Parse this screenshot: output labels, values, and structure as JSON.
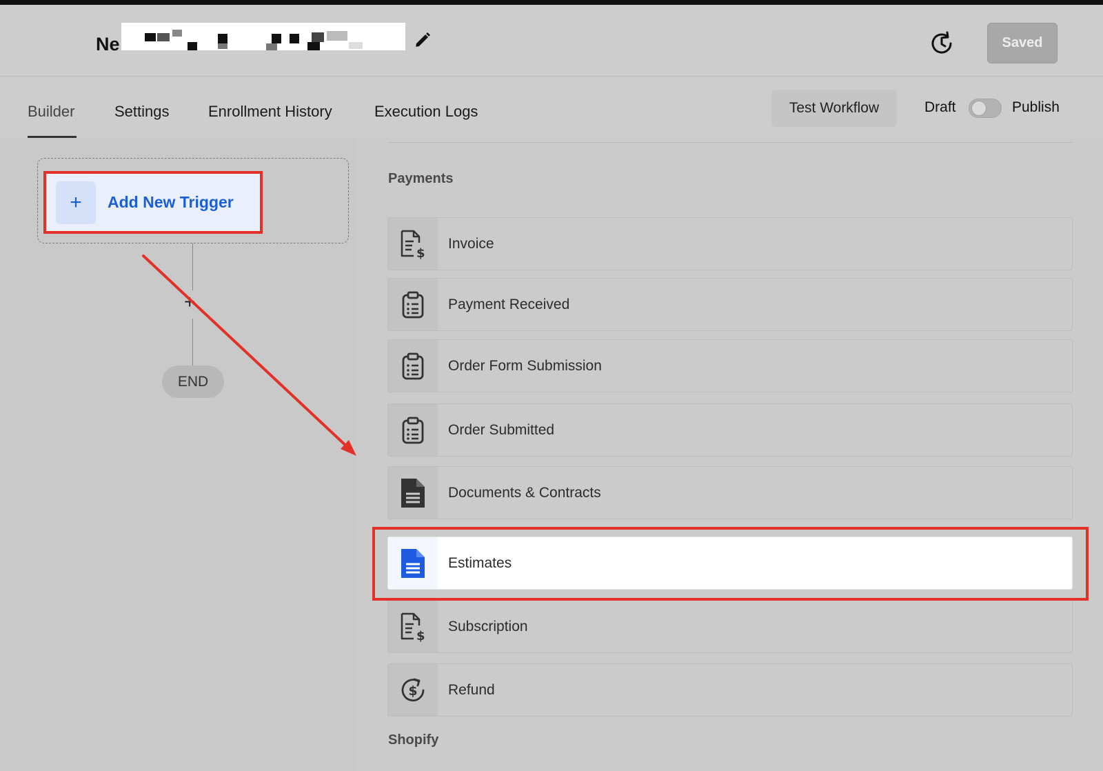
{
  "header": {
    "workflow_title": "Ne",
    "saved_label": "Saved"
  },
  "tabs": [
    {
      "label": "Builder"
    },
    {
      "label": "Settings"
    },
    {
      "label": "Enrollment History"
    },
    {
      "label": "Execution Logs"
    }
  ],
  "actions": {
    "test_label": "Test Workflow",
    "draft_label": "Draft",
    "publish_label": "Publish",
    "publish_enabled": false
  },
  "canvas": {
    "trigger_label": "Add New Trigger",
    "end_label": "END"
  },
  "panel": {
    "sections": [
      {
        "title": "Payments",
        "items": [
          {
            "label": "Invoice",
            "icon": "invoice-icon"
          },
          {
            "label": "Payment Received",
            "icon": "clipboard-list-icon"
          },
          {
            "label": "Order Form Submission",
            "icon": "clipboard-list-icon"
          },
          {
            "label": "Order Submitted",
            "icon": "clipboard-list-icon"
          },
          {
            "label": "Documents & Contracts",
            "icon": "document-icon"
          },
          {
            "label": "Estimates",
            "icon": "document-icon",
            "highlighted": true
          },
          {
            "label": "Subscription",
            "icon": "invoice-icon"
          },
          {
            "label": "Refund",
            "icon": "refund-icon"
          }
        ]
      },
      {
        "title": "Shopify",
        "items": []
      }
    ]
  },
  "colors": {
    "accent": "#1b5fd6",
    "annotation": "#e23128"
  }
}
